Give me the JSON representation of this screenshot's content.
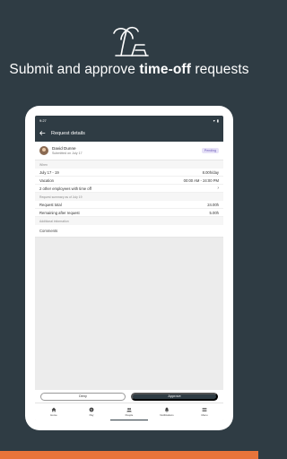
{
  "headline": {
    "prefix": "Submit and approve ",
    "bold": "time-off",
    "suffix": " requests"
  },
  "status_bar": {
    "time": "9:27"
  },
  "app_bar": {
    "title": "Request details"
  },
  "request": {
    "name": "David Dunne",
    "submitted": "Submitted on July 17",
    "status": "Pending"
  },
  "when": {
    "label": "When",
    "date": "July 17 - 19",
    "duration": "8.00h/day",
    "type": "Vacation",
    "time_range": "00:00 AM - 24:00 PM",
    "others": "2 other employees with time off"
  },
  "summary": {
    "label": "Request summary as of July 19",
    "total_label": "Request total",
    "total_value": "24.00h",
    "remaining_label": "Remaining after request",
    "remaining_value": "5.00h"
  },
  "additional": {
    "label": "Additional information",
    "comments": "Comments"
  },
  "actions": {
    "deny": "Deny",
    "approve": "Approve"
  },
  "tabs": [
    {
      "label": "Home",
      "icon": "home-icon"
    },
    {
      "label": "Pay",
      "icon": "pay-icon"
    },
    {
      "label": "People",
      "icon": "people-icon"
    },
    {
      "label": "Notifications",
      "icon": "bell-icon"
    },
    {
      "label": "Menu",
      "icon": "menu-icon"
    }
  ],
  "colors": {
    "background": "#2f3c44",
    "accent": "#e8743b",
    "badge": "#6a59b8"
  }
}
